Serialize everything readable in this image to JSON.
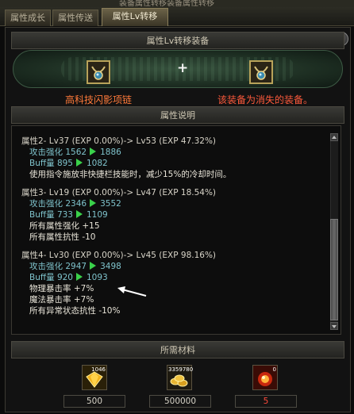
{
  "window": {
    "top_title": "装备属性转移装备属性转移"
  },
  "tabs": [
    {
      "label": "属性成长",
      "active": false
    },
    {
      "label": "属性传送",
      "active": false
    },
    {
      "label": "属性Lv转移",
      "active": true
    }
  ],
  "transfer": {
    "header": "属性Lv转移装备",
    "plus": "+",
    "left_item_name": "高科技闪影项链",
    "right_item_name": "该装备为消失的装备。"
  },
  "attributes": {
    "header": "属性说明",
    "groups": [
      {
        "title": "属性2- Lv37 (EXP 0.00%)-> Lv53 (EXP 47.32%)",
        "stats": [
          {
            "label": "攻击强化",
            "from": "1562",
            "to": "1886"
          },
          {
            "label": "Buff量",
            "from": "895",
            "to": "1082"
          }
        ],
        "notes": [
          "使用指令施放非快捷栏技能时，减少15%的冷却时间。"
        ]
      },
      {
        "title": "属性3- Lv19 (EXP 0.00%)-> Lv47 (EXP 18.54%)",
        "stats": [
          {
            "label": "攻击强化",
            "from": "2346",
            "to": "3552"
          },
          {
            "label": "Buff量",
            "from": "733",
            "to": "1109"
          }
        ],
        "notes": [
          "所有属性强化 +15",
          "所有属性抗性 -10"
        ]
      },
      {
        "title": "属性4- Lv30 (EXP 0.00%)-> Lv45 (EXP 98.16%)",
        "stats": [
          {
            "label": "攻击强化",
            "from": "2947",
            "to": "3498"
          },
          {
            "label": "Buff量",
            "from": "920",
            "to": "1093"
          }
        ],
        "notes": [
          "物理暴击率 +7%",
          "魔法暴击率 +7%",
          "所有异常状态抗性 -10%"
        ]
      }
    ]
  },
  "materials": {
    "header": "所需材料",
    "items": [
      {
        "icon": "gold-crystal-icon",
        "stock": "1046",
        "required": "500",
        "insufficient": false
      },
      {
        "icon": "gold-coins-icon",
        "stock": "3359780",
        "required": "500000",
        "insufficient": false
      },
      {
        "icon": "red-orb-icon",
        "stock": "0",
        "required": "5",
        "insufficient": true
      }
    ]
  },
  "colors": {
    "stat_label": "#7fc3cc",
    "arrow": "#3ad14a",
    "item_name": "#ff7a3a",
    "warning": "#ff5a3c"
  }
}
